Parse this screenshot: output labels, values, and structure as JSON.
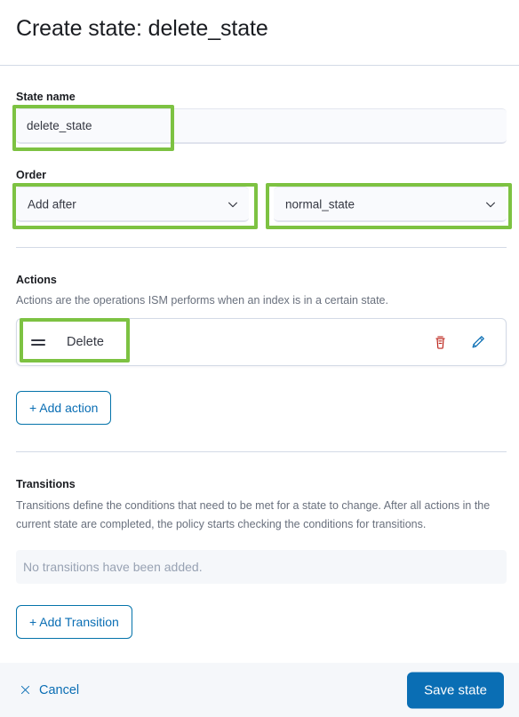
{
  "header": {
    "title": "Create state: delete_state"
  },
  "state_name": {
    "label": "State name",
    "value": "delete_state",
    "placeholder": ""
  },
  "order": {
    "label": "Order",
    "position_select": {
      "value": "Add after",
      "icon": "chevron-down-icon"
    },
    "target_select": {
      "value": "normal_state",
      "icon": "chevron-down-icon"
    }
  },
  "actions": {
    "title": "Actions",
    "help": "Actions are the operations ISM performs when an index is in a certain state.",
    "items": [
      {
        "name": "Delete",
        "drag_icon": "drag-handle-icon",
        "delete_icon": "trash-icon",
        "edit_icon": "pencil-icon"
      }
    ],
    "add_label": "+ Add action"
  },
  "transitions": {
    "title": "Transitions",
    "help": "Transitions define the conditions that need to be met for a state to change. After all actions in the current state are completed, the policy starts checking the conditions for transitions.",
    "empty_text": "No transitions have been added.",
    "add_label": "+ Add Transition"
  },
  "footer": {
    "cancel_label": "Cancel",
    "cancel_icon": "close-x-icon",
    "save_label": "Save state"
  },
  "colors": {
    "highlight": "#7dc242",
    "primary": "#0a6eb4",
    "danger": "#bd271e",
    "edit": "#0a6eb4",
    "text": "#343741",
    "muted": "#69707d",
    "field_bg": "#f9fafd",
    "footer_bg": "#f5f7fa",
    "border": "#d3dae6"
  }
}
